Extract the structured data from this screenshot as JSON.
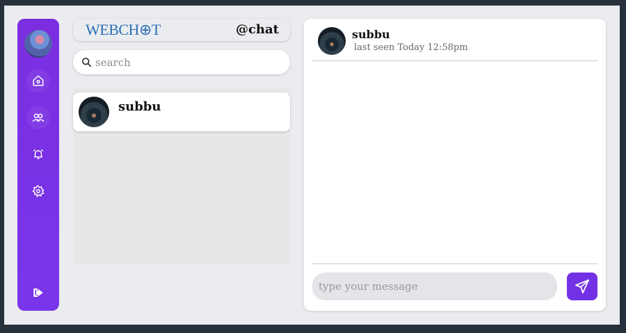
{
  "sidebar": {
    "profile_avatar": "user-avatar",
    "items": [
      {
        "name": "home",
        "icon": "home-icon"
      },
      {
        "name": "users",
        "icon": "users-icon"
      },
      {
        "name": "alarm",
        "icon": "alarm-bell-icon"
      },
      {
        "name": "settings",
        "icon": "gear-icon"
      }
    ],
    "logout_icon": "logout-icon"
  },
  "brand": {
    "logo": "WEBCH⊕T",
    "handle": "@chat"
  },
  "search": {
    "placeholder": "search",
    "value": ""
  },
  "contacts": [
    {
      "name": "subbu"
    }
  ],
  "chat": {
    "contact_name": "subbu",
    "status": "last seen Today 12:58pm",
    "input_placeholder": "type your message",
    "input_value": "",
    "send_icon": "send-icon"
  },
  "colors": {
    "accent": "#7331e6",
    "sidebar": "#7b2ee0",
    "brand_logo": "#2a6fb5",
    "background": "#ebecef",
    "frame": "#27313c"
  }
}
